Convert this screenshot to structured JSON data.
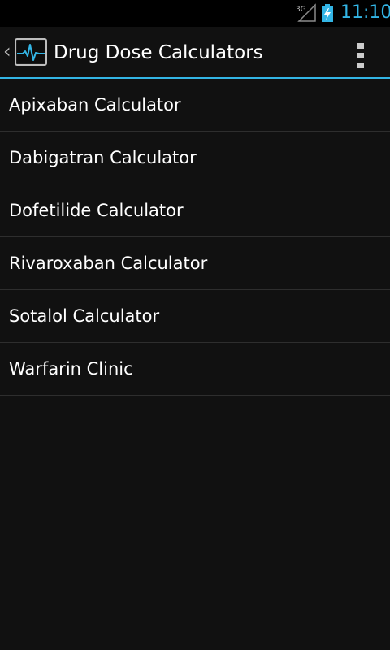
{
  "status_bar": {
    "network_type": "3G",
    "time": "11:10",
    "signal_icon": "signal-icon",
    "battery_icon": "battery-charging-icon",
    "accent_color": "#33b5e5"
  },
  "action_bar": {
    "title": "Drug Dose Calculators",
    "up_caret": "‹",
    "app_icon": "heartbeat-monitor-icon",
    "overflow_icon": "overflow-menu-icon",
    "divider_color": "#33b5e5"
  },
  "list": {
    "items": [
      {
        "label": "Apixaban Calculator"
      },
      {
        "label": "Dabigatran Calculator"
      },
      {
        "label": "Dofetilide Calculator"
      },
      {
        "label": "Rivaroxaban Calculator"
      },
      {
        "label": "Sotalol Calculator"
      },
      {
        "label": "Warfarin Clinic"
      }
    ]
  }
}
